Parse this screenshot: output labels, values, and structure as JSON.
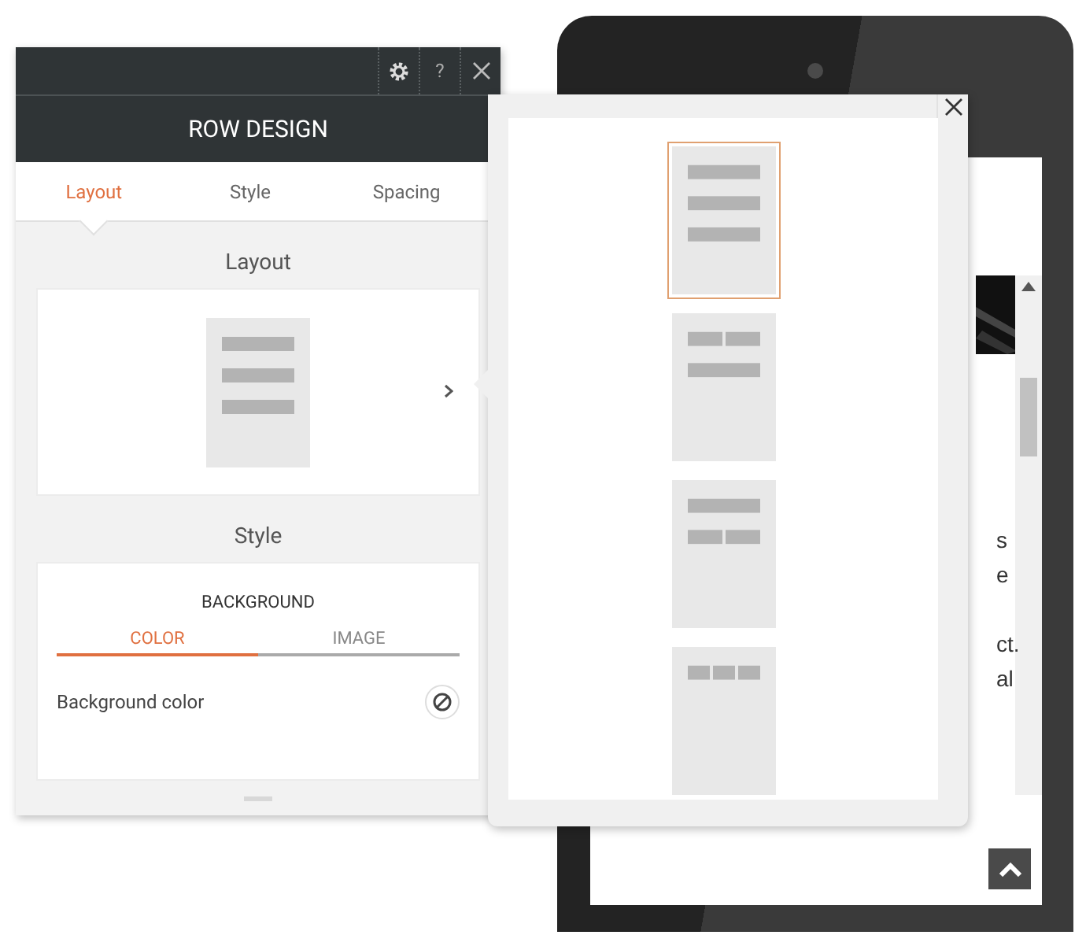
{
  "panel": {
    "help_label": "?",
    "title": "ROW DESIGN",
    "tabs": [
      {
        "label": "Layout",
        "selected": true
      },
      {
        "label": "Style",
        "selected": false
      },
      {
        "label": "Spacing",
        "selected": false
      }
    ],
    "layout_section": {
      "heading": "Layout",
      "kind": "rows3"
    },
    "style_section": {
      "heading": "Style",
      "group": "BACKGROUND",
      "tabs": [
        {
          "label": "COLOR",
          "selected": true
        },
        {
          "label": "IMAGE",
          "selected": false
        }
      ],
      "field": {
        "label": "Background color"
      }
    }
  },
  "picker": {
    "options": [
      {
        "kind": "rows3",
        "selected": true
      },
      {
        "kind": "two-one",
        "selected": false
      },
      {
        "kind": "one-two",
        "selected": false
      },
      {
        "kind": "three",
        "selected": false
      }
    ]
  },
  "preview": {
    "text_fragments": [
      "s",
      "e",
      "ct.",
      "al"
    ]
  }
}
